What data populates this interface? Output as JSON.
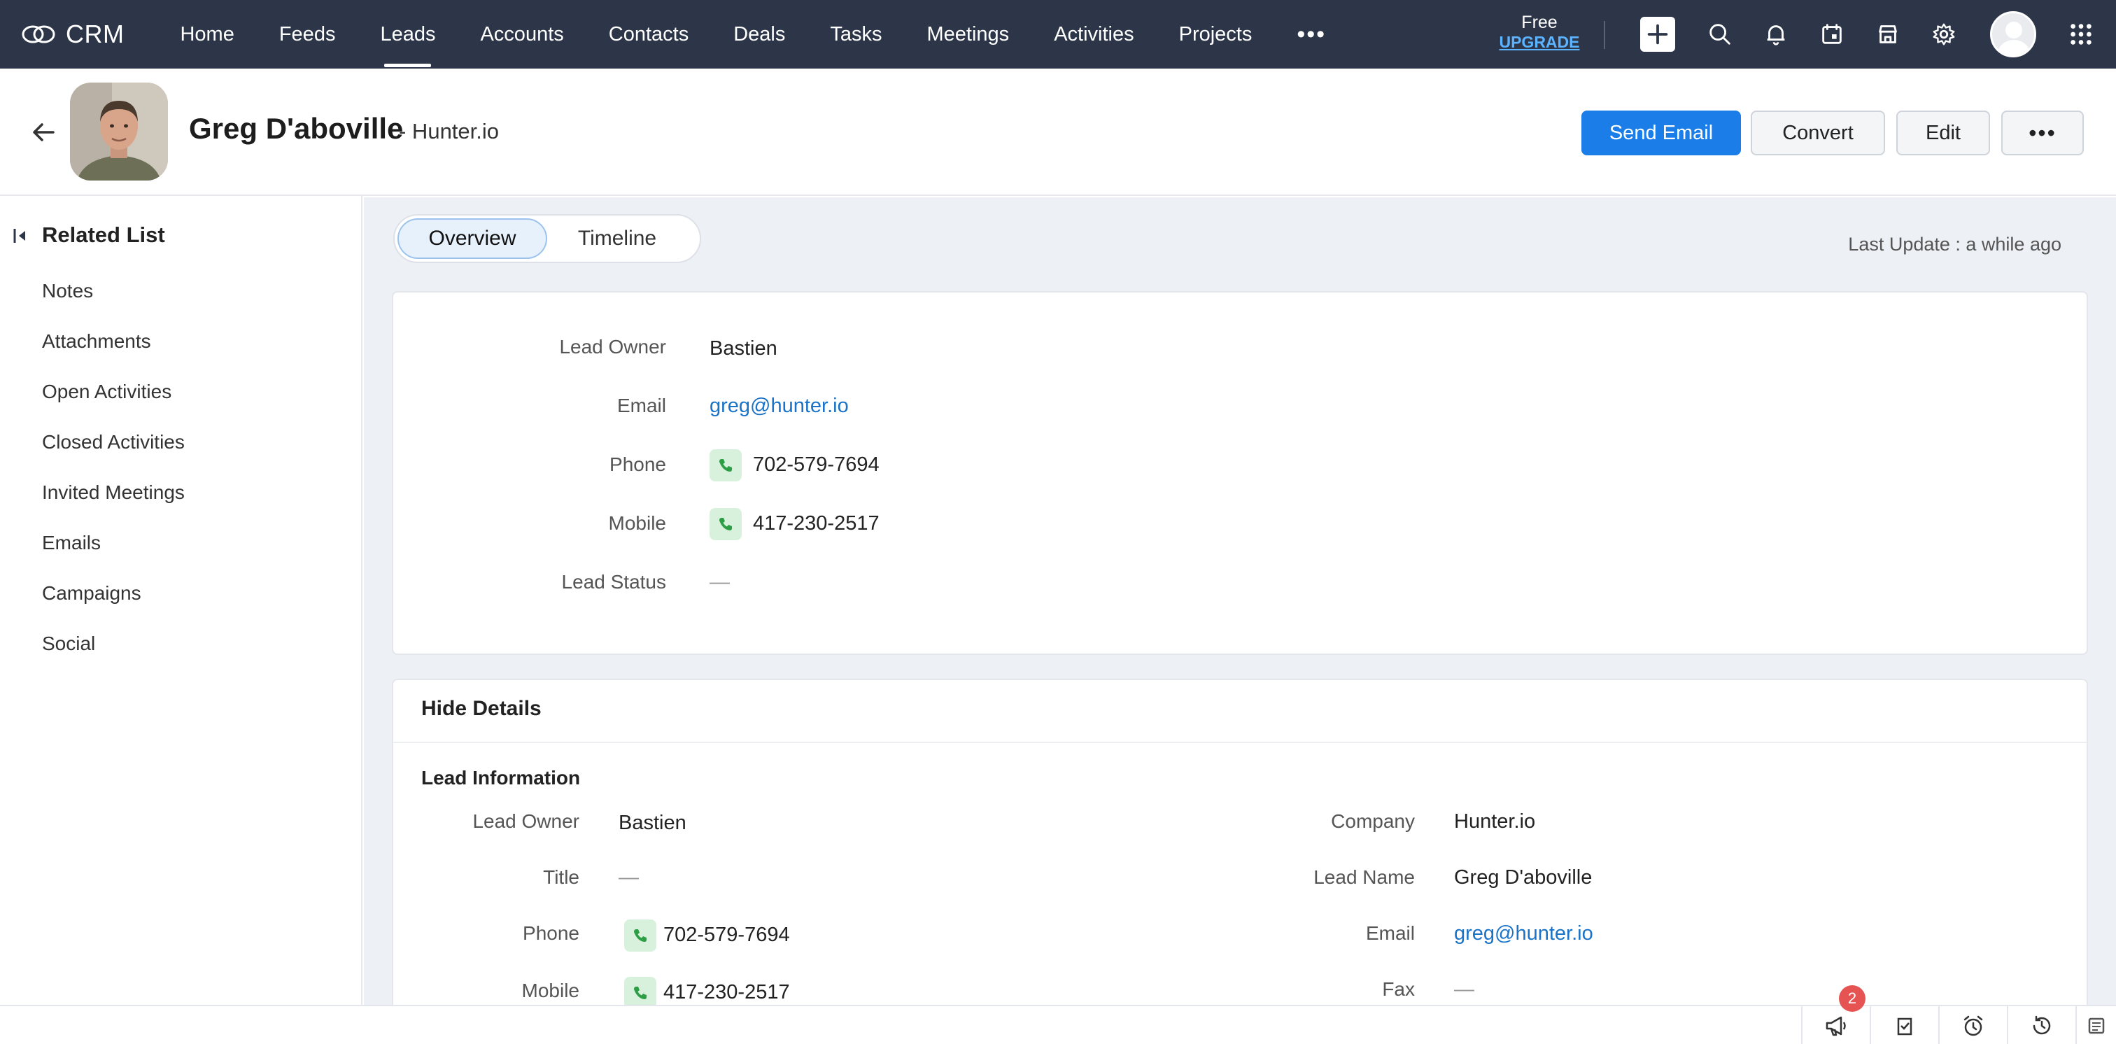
{
  "app": {
    "name": "CRM"
  },
  "nav": {
    "items": [
      {
        "label": "Home",
        "active": false
      },
      {
        "label": "Feeds",
        "active": false
      },
      {
        "label": "Leads",
        "active": true
      },
      {
        "label": "Accounts",
        "active": false
      },
      {
        "label": "Contacts",
        "active": false
      },
      {
        "label": "Deals",
        "active": false
      },
      {
        "label": "Tasks",
        "active": false
      },
      {
        "label": "Meetings",
        "active": false
      },
      {
        "label": "Activities",
        "active": false
      },
      {
        "label": "Projects",
        "active": false
      }
    ],
    "more_label": "•••",
    "plan_label": "Free",
    "upgrade_label": "UPGRADE",
    "icons": [
      "plus-icon",
      "search-icon",
      "bell-icon",
      "calendar-icon",
      "store-icon",
      "gear-icon",
      "user-avatar",
      "apps-grid-icon"
    ]
  },
  "record": {
    "name": "Greg D'aboville",
    "company_suffix": "- Hunter.io",
    "buttons": {
      "send_email": "Send Email",
      "convert": "Convert",
      "edit": "Edit",
      "more": "•••"
    }
  },
  "related_list": {
    "title": "Related List",
    "items": [
      "Notes",
      "Attachments",
      "Open Activities",
      "Closed Activities",
      "Invited Meetings",
      "Emails",
      "Campaigns",
      "Social"
    ]
  },
  "tabs": [
    {
      "label": "Overview",
      "active": true
    },
    {
      "label": "Timeline",
      "active": false
    }
  ],
  "last_update": "Last Update : a while ago",
  "overview": {
    "fields": [
      {
        "label": "Lead Owner",
        "value": "Bastien",
        "type": "text"
      },
      {
        "label": "Email",
        "value": "greg@hunter.io",
        "type": "link"
      },
      {
        "label": "Phone",
        "value": "702-579-7694",
        "type": "phone"
      },
      {
        "label": "Mobile",
        "value": "417-230-2517",
        "type": "phone"
      },
      {
        "label": "Lead Status",
        "value": "—",
        "type": "empty"
      }
    ]
  },
  "details": {
    "hide_label": "Hide Details",
    "section_title": "Lead Information",
    "left": [
      {
        "label": "Lead Owner",
        "value": "Bastien",
        "type": "text"
      },
      {
        "label": "Title",
        "value": "—",
        "type": "empty"
      },
      {
        "label": "Phone",
        "value": "702-579-7694",
        "type": "phone"
      },
      {
        "label": "Mobile",
        "value": "417-230-2517",
        "type": "phone"
      }
    ],
    "right": [
      {
        "label": "Company",
        "value": "Hunter.io",
        "type": "text"
      },
      {
        "label": "Lead Name",
        "value": "Greg D'aboville",
        "type": "text"
      },
      {
        "label": "Email",
        "value": "greg@hunter.io",
        "type": "link"
      },
      {
        "label": "Fax",
        "value": "—",
        "type": "empty"
      }
    ]
  },
  "bottom_bar": {
    "notification_count": "2",
    "icons": [
      "megaphone-icon",
      "checklist-icon",
      "alarm-clock-icon",
      "history-icon",
      "notes-icon"
    ]
  },
  "colors": {
    "nav_bg": "#2d3648",
    "primary": "#1a7de8",
    "link": "#1a73c7",
    "phone_chip": "#d8f1dc"
  }
}
